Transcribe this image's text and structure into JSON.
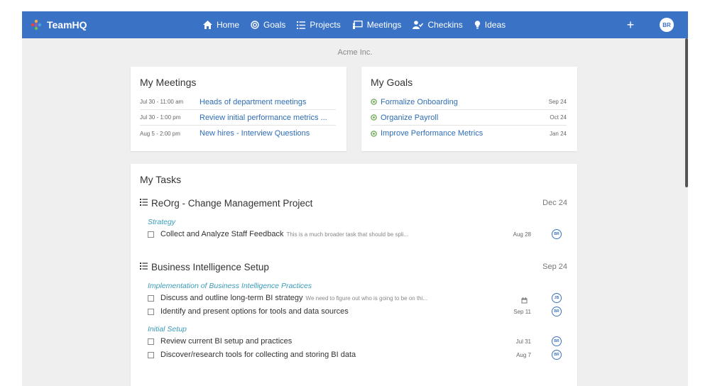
{
  "app": {
    "name": "TeamHQ",
    "org": "Acme Inc.",
    "user_initials": "BR",
    "add_label": "+"
  },
  "nav": [
    {
      "label": "Home",
      "icon": "home-icon"
    },
    {
      "label": "Goals",
      "icon": "target-icon"
    },
    {
      "label": "Projects",
      "icon": "list-icon"
    },
    {
      "label": "Meetings",
      "icon": "presentation-icon"
    },
    {
      "label": "Checkins",
      "icon": "user-check-icon"
    },
    {
      "label": "Ideas",
      "icon": "lightbulb-icon"
    }
  ],
  "meetings": {
    "title": "My Meetings",
    "items": [
      {
        "date": "Jul 30 - 11:00 am",
        "title": "Heads of department meetings"
      },
      {
        "date": "Jul 30 - 1:00 pm",
        "title": "Review initial performance metrics ..."
      },
      {
        "date": "Aug 5 - 2:00 pm",
        "title": "New hires - Interview Questions"
      }
    ]
  },
  "goals": {
    "title": "My Goals",
    "items": [
      {
        "title": "Formalize Onboarding",
        "date": "Sep 24"
      },
      {
        "title": "Organize Payroll",
        "date": "Oct 24"
      },
      {
        "title": "Improve Performance Metrics",
        "date": "Jan 24"
      }
    ]
  },
  "tasks": {
    "title": "My Tasks",
    "projects": [
      {
        "name": "ReOrg - Change Management Project",
        "date": "Dec 24",
        "sections": [
          {
            "name": "Strategy",
            "tasks": [
              {
                "title": "Collect and Analyze Staff Feedback",
                "desc": "This is a much broader task that should be spli...",
                "date": "Aug 28",
                "assignee": "BR"
              }
            ]
          }
        ]
      },
      {
        "name": "Business Intelligence Setup",
        "date": "Sep 24",
        "sections": [
          {
            "name": "Implementation of Business Intelligence Practices",
            "tasks": [
              {
                "title": "Discuss and outline long-term BI strategy",
                "desc": "We need to figure out who is going to be on thi...",
                "date": "",
                "assignee": "JB"
              },
              {
                "title": "Identify and present options for tools and data sources",
                "desc": "",
                "date": "Sep 11",
                "assignee": "BR"
              }
            ]
          },
          {
            "name": "Initial Setup",
            "tasks": [
              {
                "title": "Review current BI setup and practices",
                "desc": "",
                "date": "Jul 31",
                "assignee": "BR"
              },
              {
                "title": "Discover/research tools for collecting and storing BI data",
                "desc": "",
                "date": "Aug 7",
                "assignee": "BR"
              }
            ]
          }
        ]
      }
    ]
  },
  "colors": {
    "accent": "#3a72c6",
    "link": "#2f6db5",
    "section": "#3a9bb8",
    "goal_icon": "#6aa84f"
  }
}
